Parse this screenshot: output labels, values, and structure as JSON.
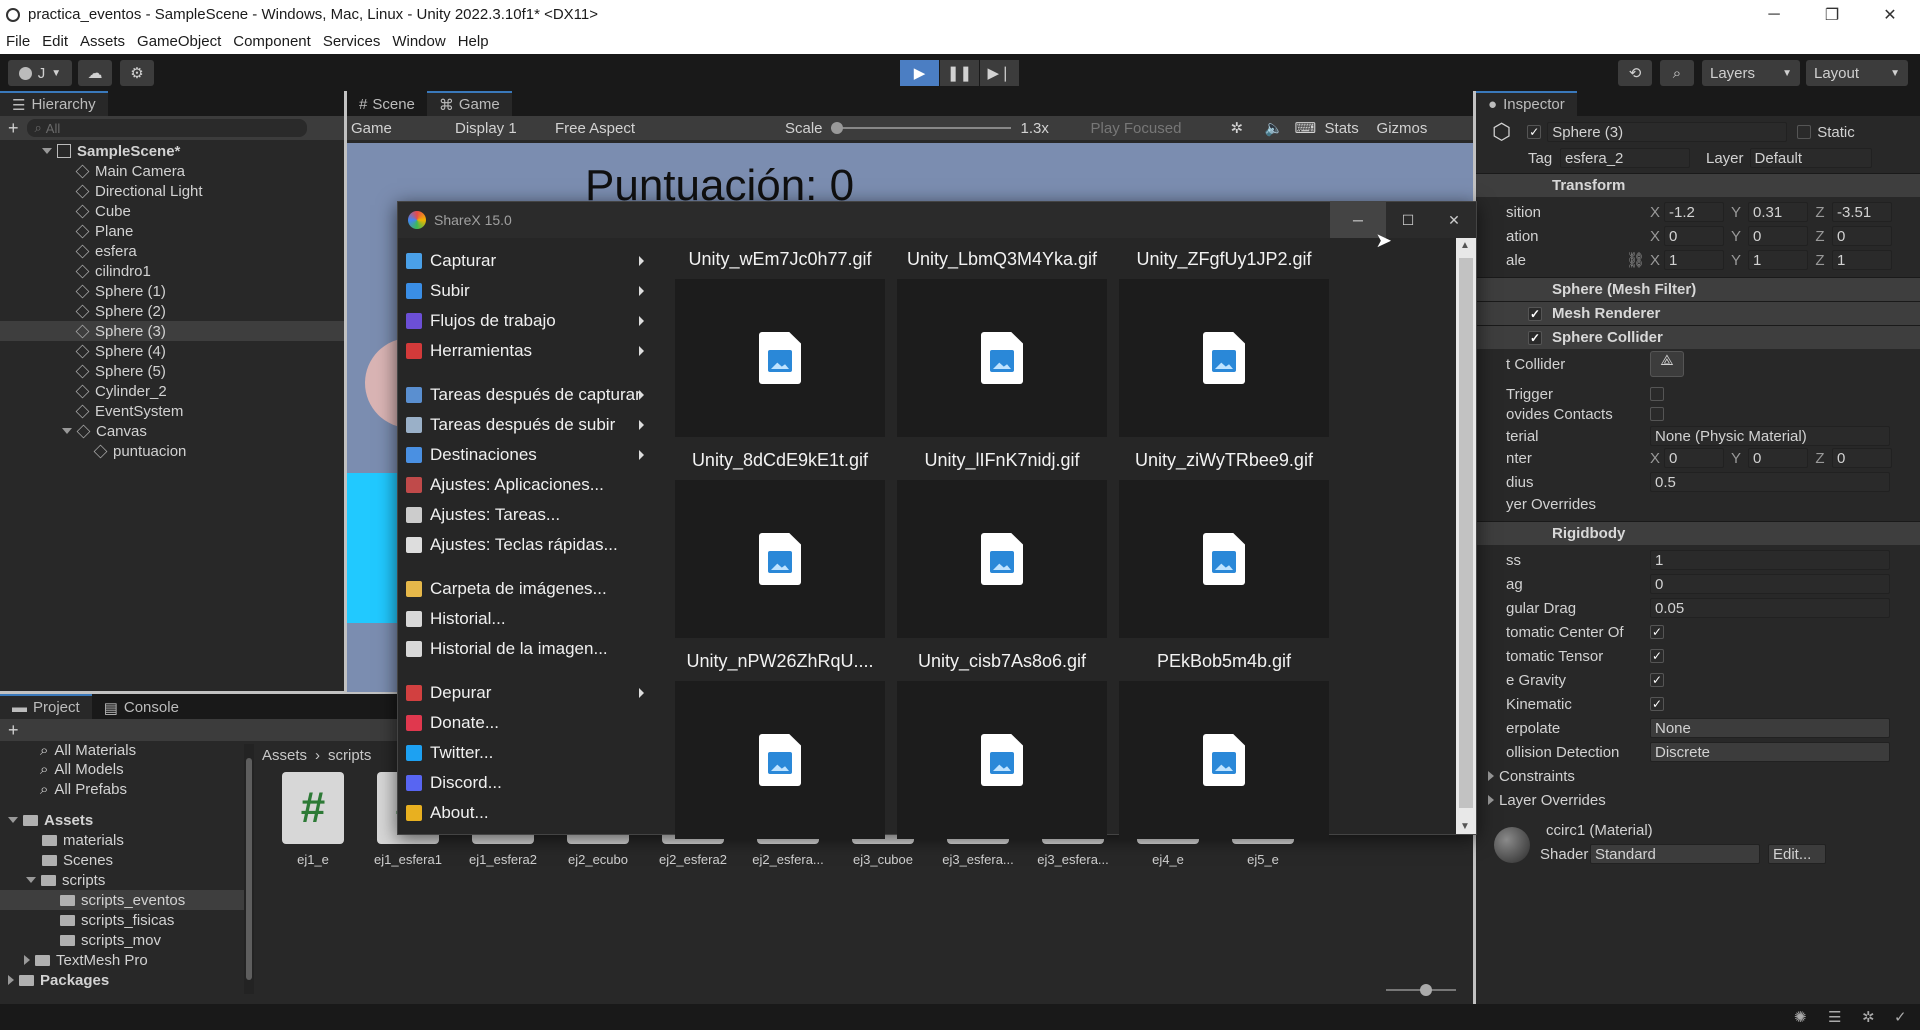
{
  "window": {
    "title": "practica_eventos - SampleScene - Windows, Mac, Linux - Unity 2022.3.10f1* <DX11>",
    "minimize": "─",
    "maximize": "❐",
    "close": "✕"
  },
  "menubar": [
    "File",
    "Edit",
    "Assets",
    "GameObject",
    "Component",
    "Services",
    "Window",
    "Help"
  ],
  "toolbar": {
    "account": "J",
    "layers": "Layers",
    "layout": "Layout"
  },
  "hierarchy": {
    "tab": "Hierarchy",
    "search_placeholder": "All",
    "scene": "SampleScene*",
    "items": [
      "Main Camera",
      "Directional Light",
      "Cube",
      "Plane",
      "esfera",
      "cilindro1",
      "Sphere (1)",
      "Sphere (2)",
      "Sphere (3)",
      "Sphere (4)",
      "Sphere (5)",
      "Cylinder_2",
      "EventSystem",
      "Canvas",
      "puntuacion"
    ]
  },
  "view": {
    "tabs": [
      "Scene",
      "Game"
    ],
    "game_dropdown": "Game",
    "display": "Display 1",
    "aspect": "Free Aspect",
    "scale_label": "Scale",
    "scale_value": "1.3x",
    "play_focused": "Play Focused",
    "stats": "Stats",
    "gizmos": "Gizmos",
    "score_text": "Puntuación: 0"
  },
  "inspector": {
    "tab": "Inspector",
    "object_name": "Sphere (3)",
    "static_label": "Static",
    "tag_label": "Tag",
    "tag_value": "esfera_2",
    "layer_label": "Layer",
    "layer_value": "Default",
    "transform": {
      "title": "Transform",
      "rows": [
        {
          "label": "sition",
          "x": "-1.2",
          "y": "0.31",
          "z": "-3.51"
        },
        {
          "label": "ation",
          "x": "0",
          "y": "0",
          "z": "0"
        },
        {
          "label": "ale",
          "x": "1",
          "y": "1",
          "z": "1"
        }
      ]
    },
    "mesh_filter": "Sphere (Mesh Filter)",
    "mesh_renderer": "Mesh Renderer",
    "collider": {
      "title": "Sphere Collider",
      "edit_label": "t Collider",
      "trigger": "Trigger",
      "provides_contacts": "ovides Contacts",
      "material_label": "terial",
      "material_value": "None (Physic Material)",
      "center_label": "nter",
      "center": {
        "x": "0",
        "y": "0",
        "z": "0"
      },
      "radius_label": "dius",
      "radius": "0.5",
      "layer_overrides": "yer Overrides"
    },
    "rigidbody": {
      "title": "Rigidbody",
      "mass_label": "ss",
      "mass": "1",
      "drag_label": "ag",
      "drag": "0",
      "angular_label": "gular Drag",
      "angular": "0.05",
      "auto_center": "tomatic Center Of",
      "auto_tensor": "tomatic Tensor",
      "gravity": "e Gravity",
      "kinematic": "Kinematic",
      "interp_label": "erpolate",
      "interp_value": "None",
      "collision_label": "ollision Detection",
      "collision_value": "Discrete",
      "constraints": "Constraints",
      "layer_overrides": "Layer Overrides"
    },
    "material": {
      "name": "ccirc1 (Material)",
      "shader_label": "Shader",
      "shader_value": "Standard",
      "edit": "Edit..."
    }
  },
  "project": {
    "tabs": [
      "Project",
      "Console"
    ],
    "favorites": [
      "All Materials",
      "All Models",
      "All Prefabs"
    ],
    "tree": [
      "Assets",
      "materials",
      "Scenes",
      "scripts",
      "scripts_eventos",
      "scripts_fisicas",
      "scripts_mov",
      "TextMesh Pro",
      "Packages"
    ],
    "breadcrumb": [
      "Assets",
      "scripts"
    ],
    "assets": [
      "ej1_e",
      "ej1_esfera1",
      "ej1_esfera2",
      "ej2_ecubo",
      "ej2_esfera2",
      "ej2_esfera...",
      "ej3_cuboe",
      "ej3_esfera...",
      "ej3_esfera...",
      "ej4_e",
      "ej5_e"
    ]
  },
  "sharex": {
    "title": "ShareX 15.0",
    "menu": [
      {
        "label": "Capturar",
        "color": "#4aa0e8",
        "sub": true
      },
      {
        "label": "Subir",
        "color": "#3a8ee6",
        "sub": true
      },
      {
        "label": "Flujos de trabajo",
        "color": "#6c4fd6",
        "sub": true
      },
      {
        "label": "Herramientas",
        "color": "#d33a3a",
        "sub": true
      },
      {
        "label": "Tareas después de capturar",
        "color": "#5a8fd0",
        "sub": true,
        "gap": true
      },
      {
        "label": "Tareas después de subir",
        "color": "#9ab0c8",
        "sub": true
      },
      {
        "label": "Destinaciones",
        "color": "#4a90e2",
        "sub": true
      },
      {
        "label": "Ajustes: Aplicaciones...",
        "color": "#c04a4a",
        "sub": false
      },
      {
        "label": "Ajustes: Tareas...",
        "color": "#cccccc",
        "sub": false
      },
      {
        "label": "Ajustes: Teclas rápidas...",
        "color": "#dddddd",
        "sub": false
      },
      {
        "label": "Carpeta de imágenes...",
        "color": "#e6b84a",
        "sub": false,
        "gap": true
      },
      {
        "label": "Historial...",
        "color": "#d8d8d8",
        "sub": false
      },
      {
        "label": "Historial de la imagen...",
        "color": "#d8d8d8",
        "sub": false
      },
      {
        "label": "Depurar",
        "color": "#d24040",
        "sub": true,
        "gap": true
      },
      {
        "label": "Donate...",
        "color": "#e0384e",
        "sub": false
      },
      {
        "label": "Twitter...",
        "color": "#1da1f2",
        "sub": false
      },
      {
        "label": "Discord...",
        "color": "#5865f2",
        "sub": false
      },
      {
        "label": "About...",
        "color": "#e8b020",
        "sub": false
      }
    ],
    "files": [
      "Unity_wEm7Jc0h77.gif",
      "Unity_LbmQ3M4Yka.gif",
      "Unity_ZFgfUy1JP2.gif",
      "Unity_8dCdE9kE1t.gif",
      "Unity_lIFnK7nidj.gif",
      "Unity_ziWyTRbee9.gif",
      "Unity_nPW26ZhRqU....",
      "Unity_cisb7As8o6.gif",
      "PEkBob5m4b.gif"
    ]
  }
}
